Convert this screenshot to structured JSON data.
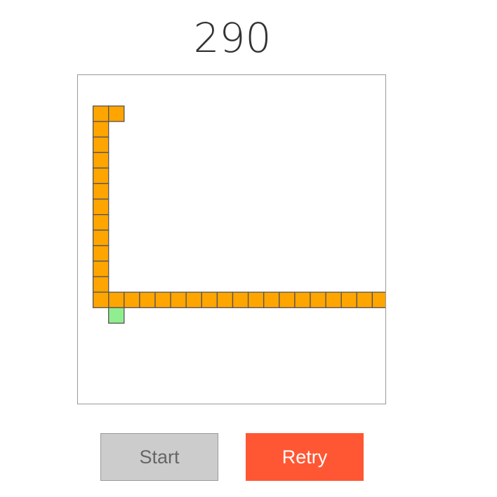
{
  "score": "290",
  "buttons": {
    "start_label": "Start",
    "retry_label": "Retry"
  },
  "board": {
    "columns": 20,
    "rows": 21,
    "snake_color": "#ffa500",
    "food_color": "#90ee90",
    "outline_color": "#555555",
    "snake": [
      [
        1,
        2
      ],
      [
        1,
        3
      ],
      [
        1,
        4
      ],
      [
        1,
        5
      ],
      [
        1,
        6
      ],
      [
        1,
        7
      ],
      [
        1,
        8
      ],
      [
        1,
        9
      ],
      [
        1,
        10
      ],
      [
        1,
        11
      ],
      [
        1,
        12
      ],
      [
        1,
        13
      ],
      [
        2,
        2
      ],
      [
        2,
        14
      ],
      [
        3,
        14
      ],
      [
        4,
        14
      ],
      [
        5,
        14
      ],
      [
        6,
        14
      ],
      [
        7,
        14
      ],
      [
        8,
        14
      ],
      [
        9,
        14
      ],
      [
        10,
        14
      ],
      [
        11,
        14
      ],
      [
        12,
        14
      ],
      [
        13,
        14
      ],
      [
        14,
        14
      ],
      [
        15,
        14
      ],
      [
        16,
        14
      ],
      [
        17,
        14
      ],
      [
        18,
        14
      ],
      [
        19,
        14
      ],
      [
        1,
        14
      ]
    ],
    "food": [
      [
        2,
        15
      ]
    ]
  },
  "colors": {
    "retry_bg": "#ff5733",
    "start_bg": "#cccccc",
    "board_border": "#999999"
  }
}
